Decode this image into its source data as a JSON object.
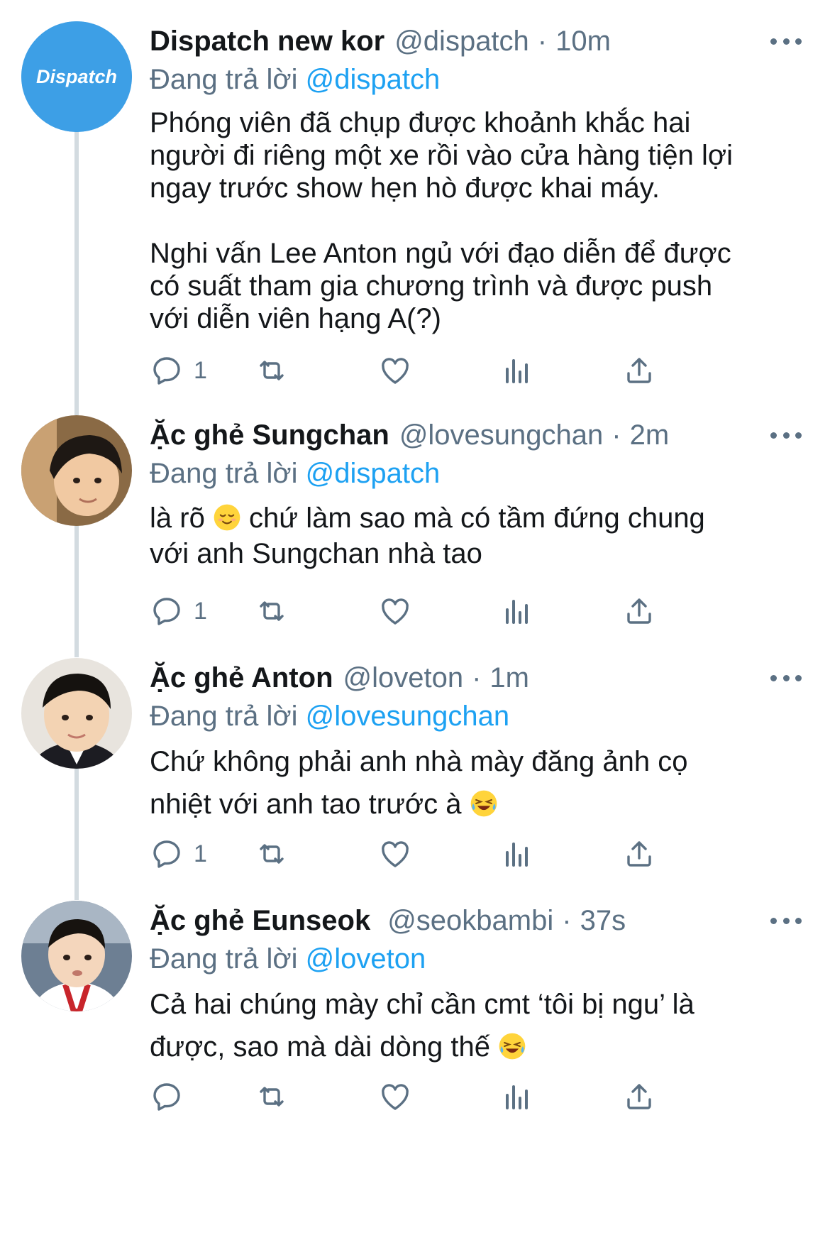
{
  "tweets": [
    {
      "name": "Dispatch new kor",
      "handle": "@dispatch",
      "time": "10m",
      "reply_prefix": "Đang trả lời",
      "reply_to": "@dispatch",
      "text": "Phóng viên đã chụp được khoảnh khắc hai\nngười đi riêng một xe rồi vào cửa hàng tiện lợi\nngay trước show hẹn hò được khai máy.\n\nNghi vấn Lee Anton ngủ với đạo diễn để được\ncó suất tham gia chương trình và được push\nvới diễn viên hạng A(?)",
      "avatar_text": "Dispatch",
      "reply_count": "1"
    },
    {
      "name": "Ặc ghẻ Sungchan",
      "handle": "@lovesungchan",
      "time": "2m",
      "reply_prefix": "Đang trả lời",
      "reply_to": "@dispatch",
      "text_a": "là rõ",
      "text_b": " chứ làm sao mà có tầm đứng chung\nvới anh Sungchan nhà tao",
      "reply_count": "1"
    },
    {
      "name": "Ặc ghẻ Anton",
      "handle": "@loveton",
      "time": "1m",
      "reply_prefix": "Đang trả lời",
      "reply_to": "@lovesungchan",
      "text_a": "Chứ không phải anh nhà mày đăng ảnh cọ\nnhiệt với anh tao trước à",
      "reply_count": "1"
    },
    {
      "name": "Ặc ghẻ Eunseok",
      "handle": "@seokbambi",
      "time": "37s",
      "reply_prefix": "Đang trả lời",
      "reply_to": "@loveton",
      "text_a": "Cả hai chúng mày chỉ cần cmt ‘tôi bị ngu’ là\nđược, sao mà dài dòng thế",
      "reply_count": ""
    }
  ],
  "separator": "·",
  "colors": {
    "text": "#14171a",
    "secondary": "#5b7083",
    "link": "#1da1f2",
    "thread_line": "#d3dbe0"
  },
  "icons": [
    "reply-icon",
    "retweet-icon",
    "like-icon",
    "analytics-icon",
    "share-icon",
    "more-icon"
  ]
}
